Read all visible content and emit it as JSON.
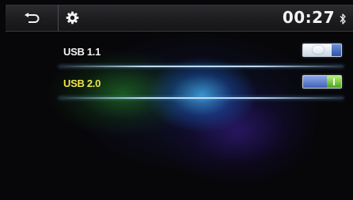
{
  "status_bar": {
    "time": "00:27",
    "icons": [
      "back-arrow-icon",
      "gear-icon",
      "bluetooth-icon"
    ]
  },
  "settings": {
    "items": [
      {
        "label": "USB 1.1",
        "enabled": false,
        "label_color": "#f2f2f2"
      },
      {
        "label": "USB 2.0",
        "enabled": true,
        "label_color": "#f1e34a"
      }
    ]
  },
  "colors": {
    "accent_selected": "#f1e34a",
    "toggle_on": "#5fb52a",
    "toggle_off": "#2e55a8"
  }
}
